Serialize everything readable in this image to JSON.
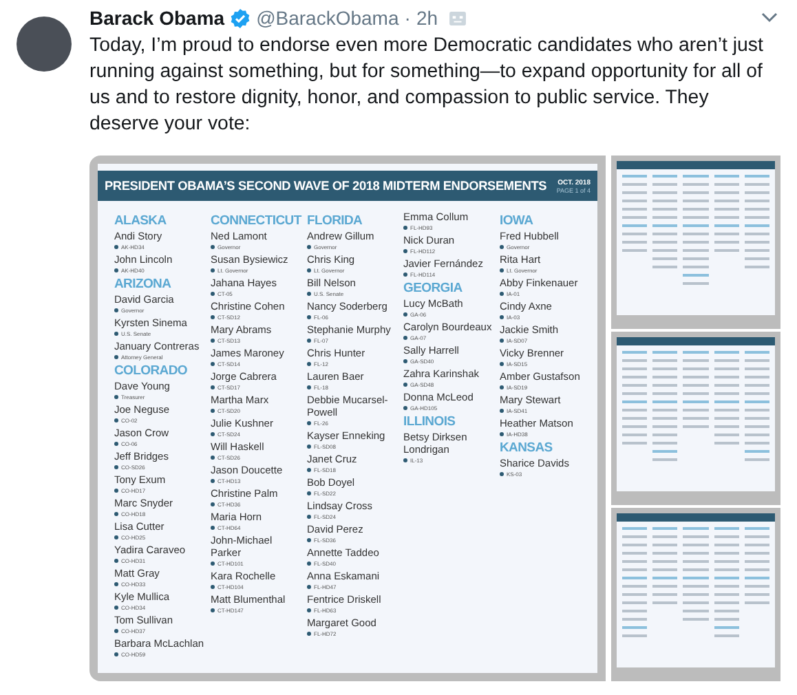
{
  "tweet": {
    "author": "Barack Obama",
    "verified": true,
    "handle": "@BarackObama",
    "separator": "·",
    "time": "2h",
    "text": "Today, I’m proud to endorse even more Democratic candidates who aren’t just running against something, but for something—to expand opportunity for all of us and to restore dignity, honor, and compassion to public service. They deserve your vote:"
  },
  "graphic": {
    "title": "PRESIDENT OBAMA’S SECOND WAVE OF 2018 MIDTERM ENDORSEMENTS",
    "date": "OCT. 2018",
    "page": "PAGE 1 of 4",
    "columns": [
      [
        {
          "heading": "ALASKA",
          "candidates": [
            {
              "name": "Andi Story",
              "office": "AK-HD34"
            },
            {
              "name": "John Lincoln",
              "office": "AK-HD40"
            }
          ]
        },
        {
          "heading": "ARIZONA",
          "candidates": [
            {
              "name": "David Garcia",
              "office": "Governor"
            },
            {
              "name": "Kyrsten Sinema",
              "office": "U.S. Senate"
            },
            {
              "name": "January Contreras",
              "office": "Attorney General"
            }
          ]
        },
        {
          "heading": "COLORADO",
          "candidates": [
            {
              "name": "Dave Young",
              "office": "Treasurer"
            },
            {
              "name": "Joe Neguse",
              "office": "CO-02"
            },
            {
              "name": "Jason Crow",
              "office": "CO-06"
            },
            {
              "name": "Jeff Bridges",
              "office": "CO-SD26"
            },
            {
              "name": "Tony Exum",
              "office": "CO-HD17"
            },
            {
              "name": "Marc Snyder",
              "office": "CO-HD18"
            },
            {
              "name": "Lisa Cutter",
              "office": "CO-HD25"
            },
            {
              "name": "Yadira Caraveo",
              "office": "CO-HD31"
            },
            {
              "name": "Matt Gray",
              "office": "CO-HD33"
            },
            {
              "name": "Kyle Mullica",
              "office": "CO-HD34"
            },
            {
              "name": "Tom Sullivan",
              "office": "CO-HD37"
            },
            {
              "name": "Barbara McLachlan",
              "office": "CO-HD59"
            }
          ]
        }
      ],
      [
        {
          "heading": "CONNECTICUT",
          "candidates": [
            {
              "name": "Ned Lamont",
              "office": "Governor"
            },
            {
              "name": "Susan Bysiewicz",
              "office": "Lt. Governor"
            },
            {
              "name": "Jahana Hayes",
              "office": "CT-05"
            },
            {
              "name": "Christine Cohen",
              "office": "CT-SD12"
            },
            {
              "name": "Mary Abrams",
              "office": "CT-SD13"
            },
            {
              "name": "James Maroney",
              "office": "CT-SD14"
            },
            {
              "name": "Jorge Cabrera",
              "office": "CT-SD17"
            },
            {
              "name": "Martha Marx",
              "office": "CT-SD20"
            },
            {
              "name": "Julie Kushner",
              "office": "CT-SD24"
            },
            {
              "name": "Will Haskell",
              "office": "CT-SD26"
            },
            {
              "name": "Jason Doucette",
              "office": "CT-HD13"
            },
            {
              "name": "Christine Palm",
              "office": "CT-HD36"
            },
            {
              "name": "Maria Horn",
              "office": "CT-HD64"
            },
            {
              "name": "John-Michael Parker",
              "office": "CT-HD101"
            },
            {
              "name": "Kara Rochelle",
              "office": "CT-HD104"
            },
            {
              "name": "Matt Blumenthal",
              "office": "CT-HD147"
            }
          ]
        }
      ],
      [
        {
          "heading": "FLORIDA",
          "candidates": [
            {
              "name": "Andrew Gillum",
              "office": "Governor"
            },
            {
              "name": "Chris King",
              "office": "Lt. Governor"
            },
            {
              "name": "Bill Nelson",
              "office": "U.S. Senate"
            },
            {
              "name": "Nancy Soderberg",
              "office": "FL-06"
            },
            {
              "name": "Stephanie Murphy",
              "office": "FL-07"
            },
            {
              "name": "Chris Hunter",
              "office": "FL-12"
            },
            {
              "name": "Lauren Baer",
              "office": "FL-18"
            },
            {
              "name": "Debbie Mucarsel-Powell",
              "office": "FL-26"
            },
            {
              "name": "Kayser Enneking",
              "office": "FL-SD08"
            },
            {
              "name": "Janet Cruz",
              "office": "FL-SD18"
            },
            {
              "name": "Bob Doyel",
              "office": "FL-SD22"
            },
            {
              "name": "Lindsay Cross",
              "office": "FL-SD24"
            },
            {
              "name": "David Perez",
              "office": "FL-SD36"
            },
            {
              "name": "Annette Taddeo",
              "office": "FL-SD40"
            },
            {
              "name": "Anna Eskamani",
              "office": "FL-HD47"
            },
            {
              "name": "Fentrice Driskell",
              "office": "FL-HD63"
            },
            {
              "name": "Margaret Good",
              "office": "FL-HD72"
            }
          ]
        }
      ],
      [
        {
          "candidates": [
            {
              "name": "Emma Collum",
              "office": "FL-HD93"
            },
            {
              "name": "Nick Duran",
              "office": "FL-HD112"
            },
            {
              "name": "Javier Fernández",
              "office": "FL-HD114"
            }
          ]
        },
        {
          "heading": "GEORGIA",
          "candidates": [
            {
              "name": "Lucy McBath",
              "office": "GA-06"
            },
            {
              "name": "Carolyn Bourdeaux",
              "office": "GA-07"
            },
            {
              "name": "Sally Harrell",
              "office": "GA-SD40"
            },
            {
              "name": "Zahra Karinshak",
              "office": "GA-SD48"
            },
            {
              "name": "Donna McLeod",
              "office": "GA-HD105"
            }
          ]
        },
        {
          "heading": "ILLINOIS",
          "candidates": [
            {
              "name": "Betsy Dirksen Londrigan",
              "office": "IL-13"
            }
          ]
        }
      ],
      [
        {
          "heading": "IOWA",
          "candidates": [
            {
              "name": "Fred Hubbell",
              "office": "Governor"
            },
            {
              "name": "Rita Hart",
              "office": "Lt. Governor"
            },
            {
              "name": "Abby Finkenauer",
              "office": "IA-01"
            },
            {
              "name": "Cindy Axne",
              "office": "IA-03"
            },
            {
              "name": "Jackie Smith",
              "office": "IA-SD07"
            },
            {
              "name": "Vicky Brenner",
              "office": "IA-SD15"
            },
            {
              "name": "Amber Gustafson",
              "office": "IA-SD19"
            },
            {
              "name": "Mary Stewart",
              "office": "IA-SD41"
            },
            {
              "name": "Heather Matson",
              "office": "IA-HD38"
            }
          ]
        },
        {
          "heading": "KANSAS",
          "candidates": [
            {
              "name": "Sharice Davids",
              "office": "KS-03"
            }
          ]
        }
      ]
    ]
  }
}
